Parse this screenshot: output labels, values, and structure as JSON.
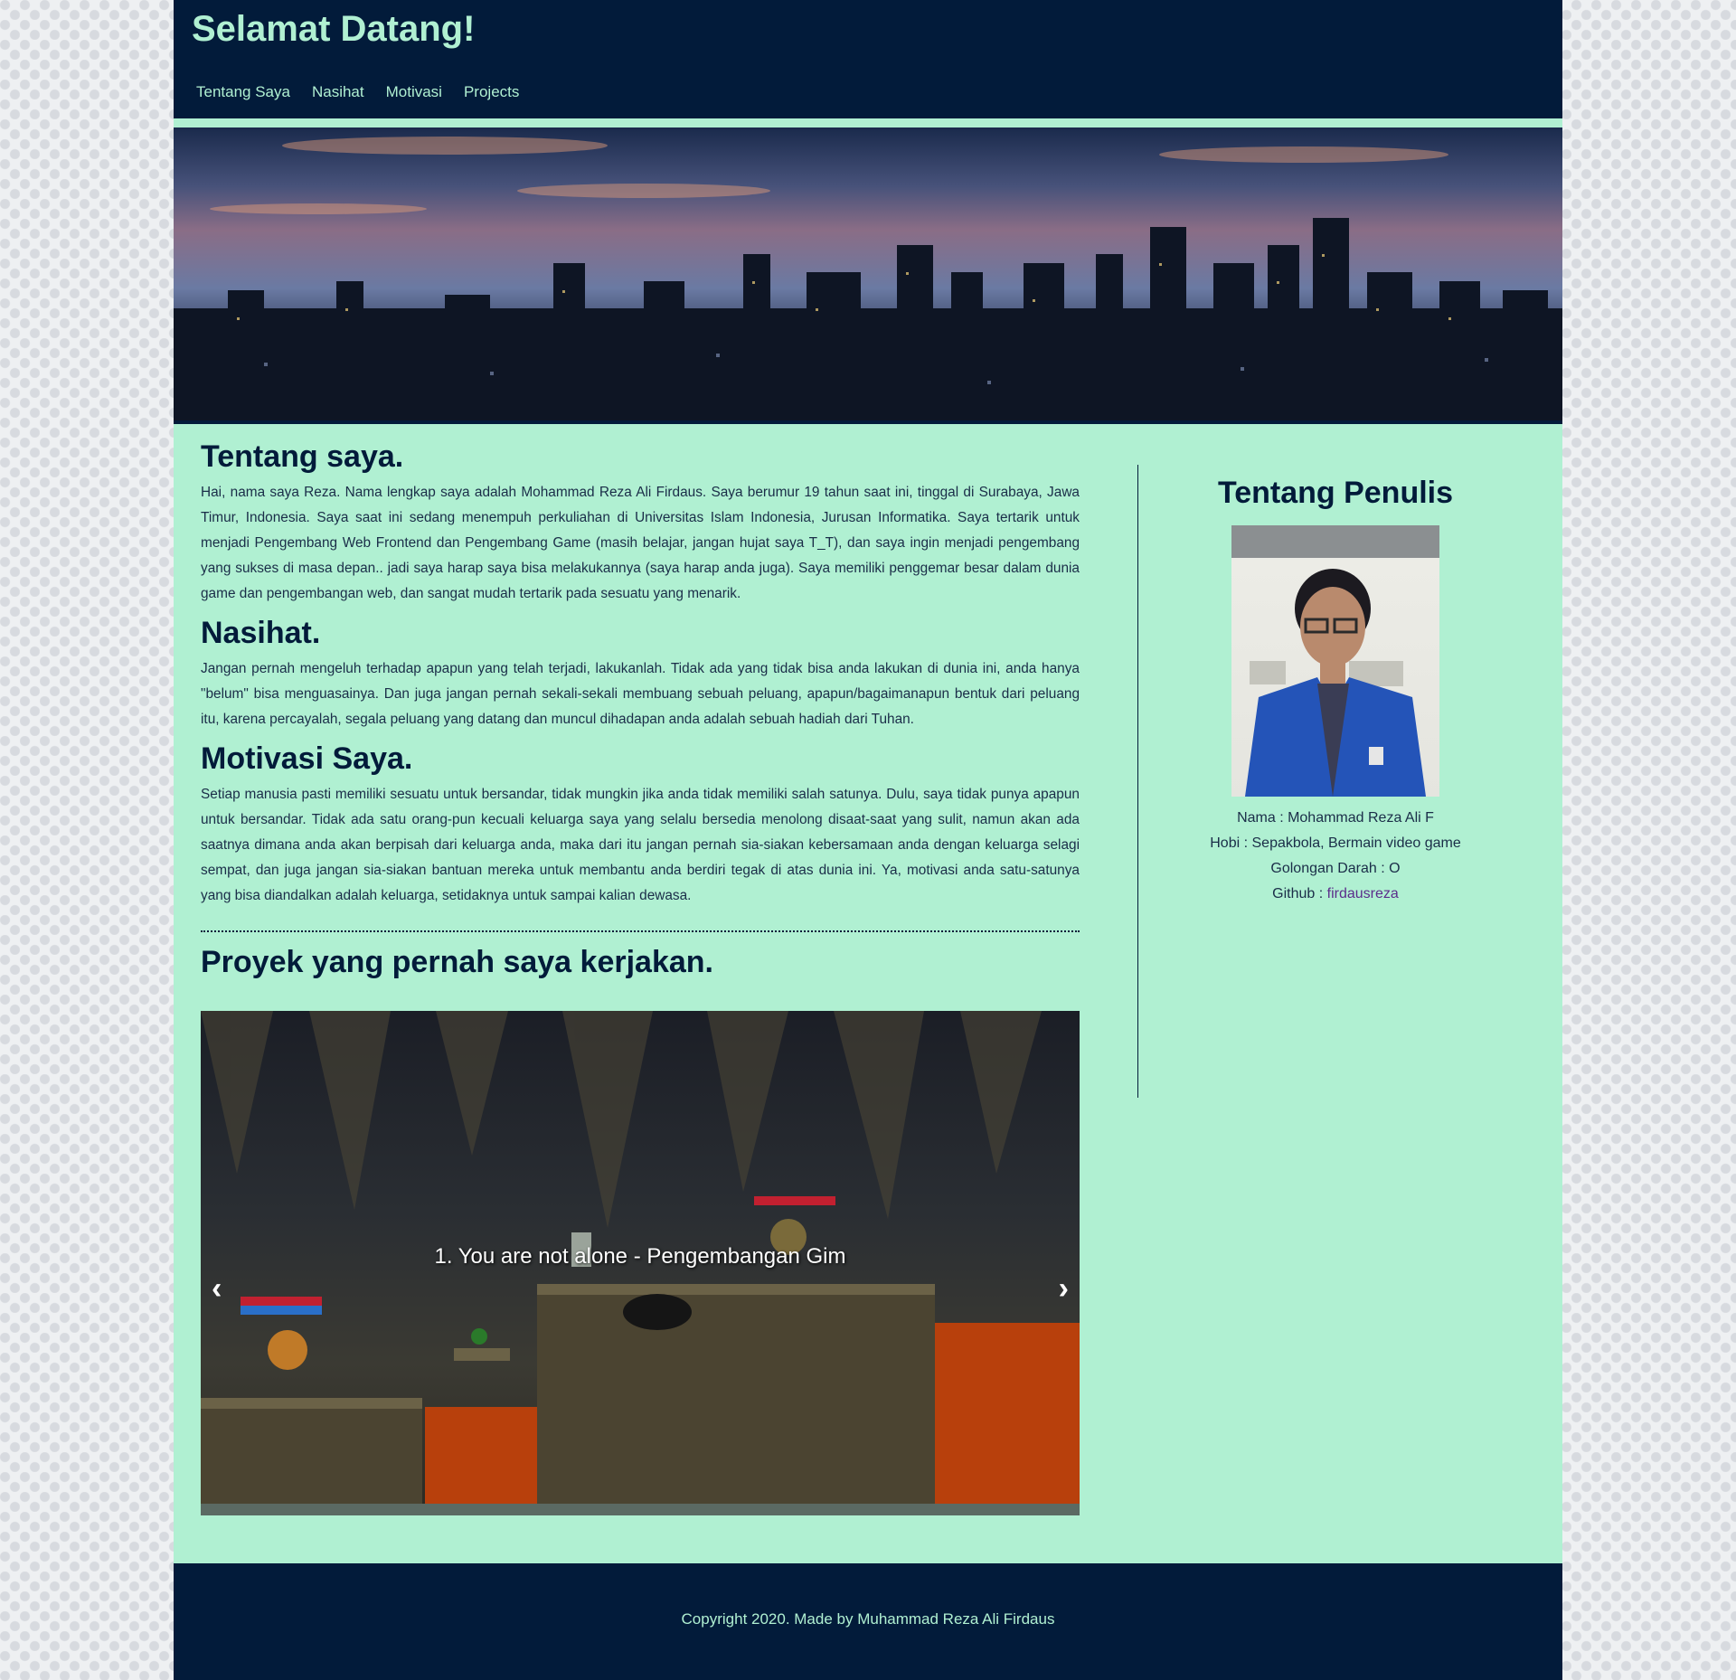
{
  "header": {
    "title": "Selamat Datang!",
    "nav": [
      "Tentang Saya",
      "Nasihat",
      "Motivasi",
      "Projects"
    ]
  },
  "sections": {
    "about_title": "Tentang saya.",
    "about_text": "Hai, nama saya Reza. Nama lengkap saya adalah Mohammad Reza Ali Firdaus. Saya berumur 19 tahun saat ini, tinggal di Surabaya, Jawa Timur, Indonesia. Saya saat ini sedang menempuh perkuliahan di Universitas Islam Indonesia, Jurusan Informatika. Saya tertarik untuk menjadi Pengembang Web Frontend dan Pengembang Game (masih belajar, jangan hujat saya T_T), dan saya ingin menjadi pengembang yang sukses di masa depan.. jadi saya harap saya bisa melakukannya (saya harap anda juga). Saya memiliki penggemar besar dalam dunia game dan pengembangan web, dan sangat mudah tertarik pada sesuatu yang menarik.",
    "advice_title": "Nasihat.",
    "advice_text": "Jangan pernah mengeluh terhadap apapun yang telah terjadi, lakukanlah. Tidak ada yang tidak bisa anda lakukan di dunia ini, anda hanya \"belum\" bisa menguasainya. Dan juga jangan pernah sekali-sekali membuang sebuah peluang, apapun/bagaimanapun bentuk dari peluang itu, karena percayalah, segala peluang yang datang dan muncul dihadapan anda adalah sebuah hadiah dari Tuhan.",
    "motivation_title": "Motivasi Saya.",
    "motivation_text": "Setiap manusia pasti memiliki sesuatu untuk bersandar, tidak mungkin jika anda tidak memiliki salah satunya. Dulu, saya tidak punya apapun untuk bersandar. Tidak ada satu orang-pun kecuali keluarga saya yang selalu bersedia menolong disaat-saat yang sulit, namun akan ada saatnya dimana anda akan berpisah dari keluarga anda, maka dari itu jangan pernah sia-siakan kebersamaan anda dengan keluarga selagi sempat, dan juga jangan sia-siakan bantuan mereka untuk membantu anda berdiri tegak di atas dunia ini. Ya, motivasi anda satu-satunya yang bisa diandalkan adalah keluarga, setidaknya untuk sampai kalian dewasa.",
    "projects_title": "Proyek yang pernah saya kerjakan."
  },
  "carousel": {
    "caption": "1. You are not alone - Pengembangan Gim",
    "prev": "‹",
    "next": "›"
  },
  "sidebar": {
    "title": "Tentang Penulis",
    "nama": "Nama : Mohammad Reza Ali F",
    "hobi": "Hobi : Sepakbola, Bermain video game",
    "golongan": "Golongan Darah : O",
    "github_label": "Github : ",
    "github_link": "firdausreza"
  },
  "footer": {
    "text": "Copyright 2020. Made by Muhammad Reza Ali Firdaus"
  },
  "colors": {
    "navy": "#021b3a",
    "mint": "#b0f0d2",
    "link": "#5b2d8b"
  }
}
